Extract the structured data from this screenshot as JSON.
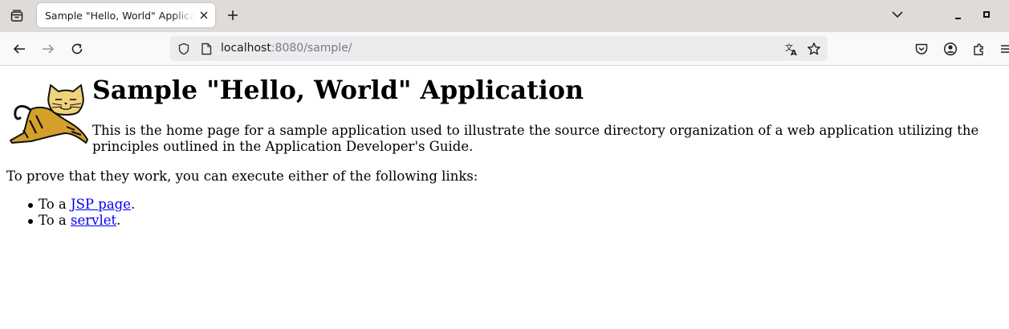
{
  "browser": {
    "tab": {
      "title": "Sample \"Hello, World\" Application"
    },
    "url": {
      "host": "localhost",
      "rest": ":8080/sample/"
    },
    "icons": {
      "tab_list": "tab-list-icon",
      "close_tab": "close-icon",
      "new_tab": "plus-icon",
      "list_all_tabs": "chevron-down-icon",
      "minimize": "minimize-icon",
      "maximize": "maximize-icon",
      "back": "back-arrow-icon",
      "forward": "forward-arrow-icon",
      "reload": "reload-icon",
      "tracking_protection": "shield-icon",
      "page_info": "page-icon",
      "translate": "translate-icon",
      "bookmark": "star-icon",
      "pocket": "pocket-icon",
      "account": "account-icon",
      "extensions": "puzzle-icon",
      "menu": "hamburger-menu-icon"
    }
  },
  "page": {
    "heading": "Sample \"Hello, World\" Application",
    "intro": "This is the home page for a sample application used to illustrate the source directory organization of a web application utilizing the principles outlined in the Application Developer's Guide.",
    "prove_text": "To prove that they work, you can execute either of the following links:",
    "links": [
      {
        "prefix": "To a ",
        "label": "JSP page",
        "suffix": "."
      },
      {
        "prefix": "To a ",
        "label": "servlet",
        "suffix": "."
      }
    ],
    "logo": "tomcat-logo",
    "link_color": "#0000ee"
  }
}
